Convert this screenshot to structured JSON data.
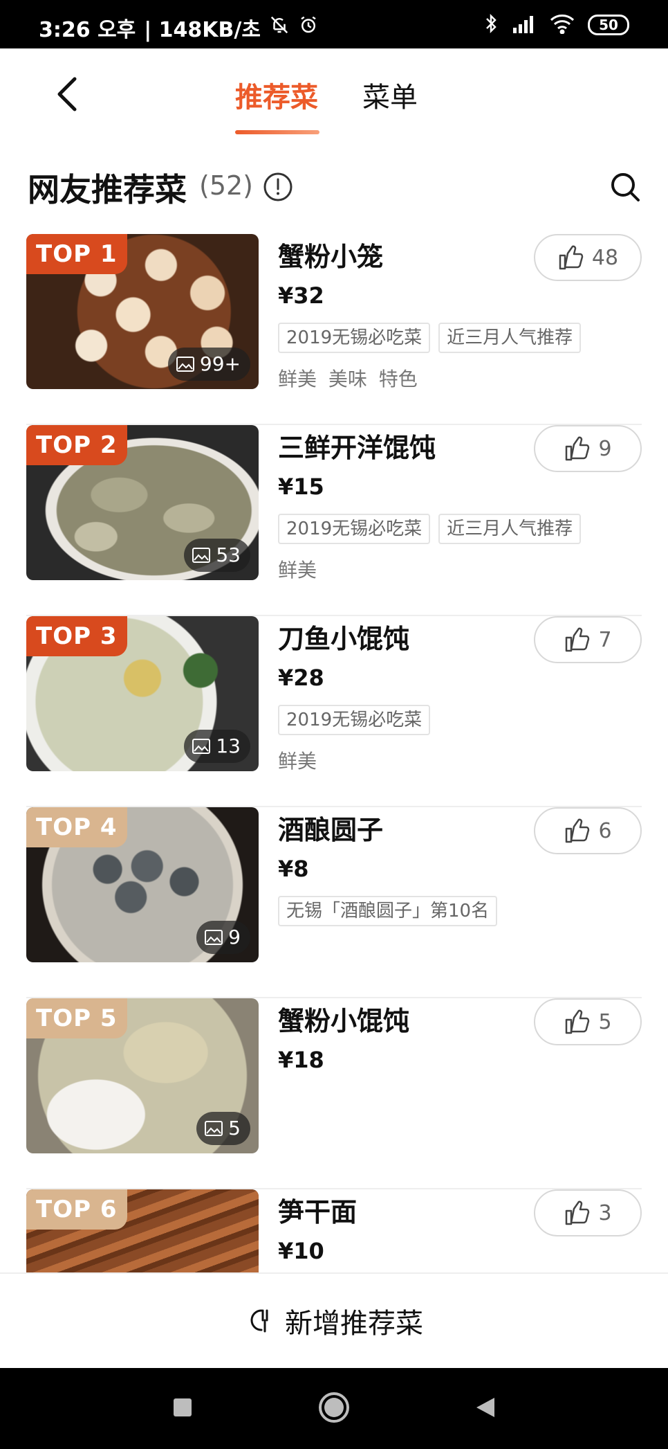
{
  "status_bar": {
    "time": "3:26 오후",
    "speed": "| 148KB/초",
    "battery": "50"
  },
  "header": {
    "tabs": [
      "推荐菜",
      "菜单"
    ]
  },
  "section": {
    "title": "网友推荐菜",
    "count": "(52)"
  },
  "dishes": [
    {
      "rank": "TOP 1",
      "name": "蟹粉小笼",
      "price": "¥32",
      "tags": [
        "2019无锡必吃菜",
        "近三月人气推荐"
      ],
      "desc": "鲜美 美味 特色",
      "photos": "99+",
      "likes": "48"
    },
    {
      "rank": "TOP 2",
      "name": "三鲜开洋馄饨",
      "price": "¥15",
      "tags": [
        "2019无锡必吃菜",
        "近三月人气推荐"
      ],
      "desc": "鲜美",
      "photos": "53",
      "likes": "9"
    },
    {
      "rank": "TOP 3",
      "name": "刀鱼小馄饨",
      "price": "¥28",
      "tags": [
        "2019无锡必吃菜"
      ],
      "desc": "鲜美",
      "photos": "13",
      "likes": "7"
    },
    {
      "rank": "TOP 4",
      "name": "酒酿圆子",
      "price": "¥8",
      "tags": [
        "无锡「酒酿圆子」第10名"
      ],
      "desc": "",
      "photos": "9",
      "likes": "6"
    },
    {
      "rank": "TOP 5",
      "name": "蟹粉小馄饨",
      "price": "¥18",
      "tags": [],
      "desc": "",
      "photos": "5",
      "likes": "5"
    },
    {
      "rank": "TOP 6",
      "name": "笋干面",
      "price": "¥10",
      "tags": [],
      "desc": "",
      "photos": "",
      "likes": "3"
    }
  ],
  "add_bar": {
    "label": "新增推荐菜"
  },
  "colors": {
    "accent": "#ec5b2a",
    "rank_hot": "#d84a1e",
    "rank_warm": "#d9b58f"
  },
  "icons": [
    "back-arrow-icon",
    "info-icon",
    "search-icon",
    "thumbs-up-icon",
    "image-icon",
    "add-dish-icon",
    "nav-recent-icon",
    "nav-home-icon",
    "nav-back-icon",
    "bluetooth-icon",
    "signal-icon",
    "wifi-icon",
    "mute-bell-icon",
    "alarm-icon"
  ]
}
